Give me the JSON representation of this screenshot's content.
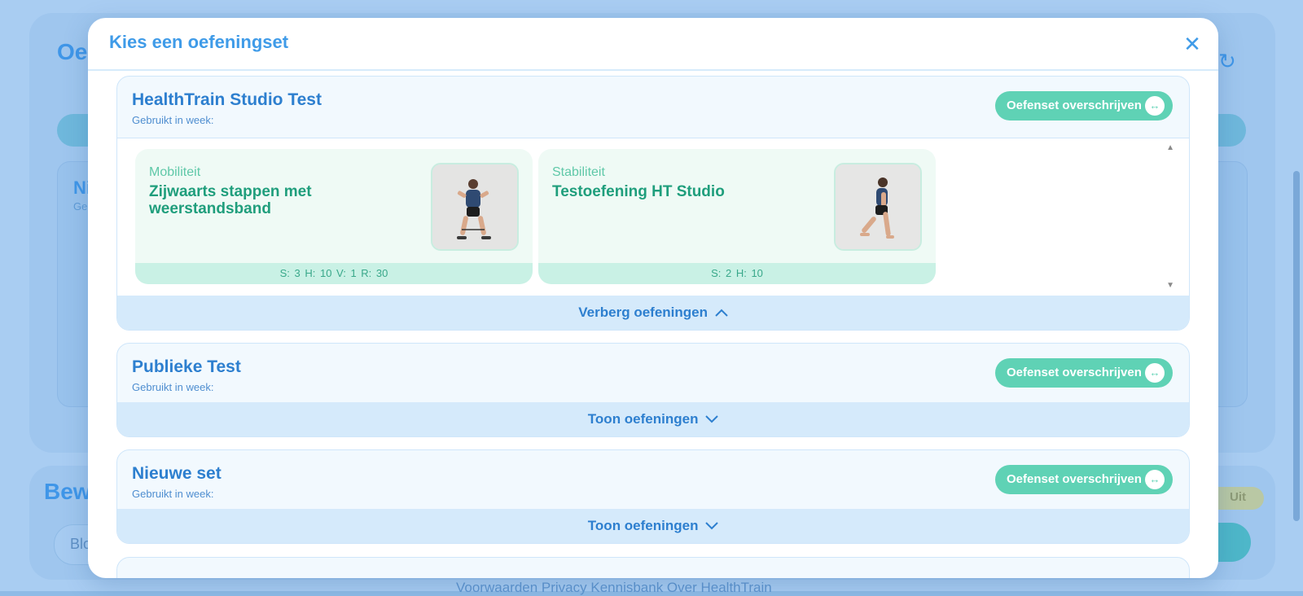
{
  "background": {
    "title_partial": "Oe",
    "inner_title_partial": "Ni",
    "inner_sub_partial": "Ge",
    "section_title_partial": "Bew",
    "input_partial": "Blo",
    "toggle_label": "Uit",
    "footer_links": "Voorwaarden  Privacy  Kennisbank  Over HealthTrain"
  },
  "modal": {
    "title": "Kies een oefeningset",
    "close_icon": "close-icon",
    "sets": [
      {
        "title": "HealthTrain Studio Test",
        "subtitle": "Gebruikt in week:",
        "button_label": "Oefenset overschrijven",
        "toggle_label": "Verberg oefeningen",
        "expanded": true,
        "exercises": [
          {
            "category": "Mobiliteit",
            "name": "Zijwaarts stappen met weerstandsband",
            "stats": "S: 3   H: 10   V: 1   R: 30"
          },
          {
            "category": "Stabiliteit",
            "name": "Testoefening HT Studio",
            "stats": "S: 2   H: 10"
          }
        ]
      },
      {
        "title": "Publieke Test",
        "subtitle": "Gebruikt in week:",
        "button_label": "Oefenset overschrijven",
        "toggle_label": "Toon oefeningen",
        "expanded": false
      },
      {
        "title": "Nieuwe set",
        "subtitle": "Gebruikt in week:",
        "button_label": "Oefenset overschrijven",
        "toggle_label": "Toon oefeningen",
        "expanded": false
      }
    ]
  },
  "colors": {
    "accent_blue": "#3f9be8",
    "accent_green": "#5fd2b5",
    "exercise_green": "#1f9e7c"
  }
}
